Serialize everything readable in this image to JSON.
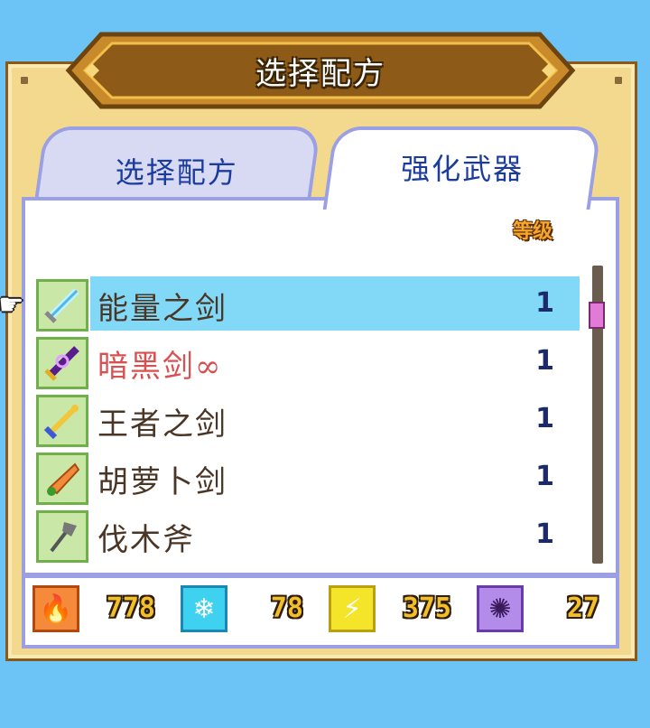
{
  "title": "选择配方",
  "tabs": {
    "recipe": "选择配方",
    "enhance": "强化武器"
  },
  "list_header": {
    "level": "等级"
  },
  "weapons": [
    {
      "name": "能量之剑",
      "level": "1",
      "icon": "energy-sword-icon",
      "selected": true
    },
    {
      "name": "暗黑剑∞",
      "level": "1",
      "icon": "dark-sword-icon",
      "selected": false
    },
    {
      "name": "王者之剑",
      "level": "1",
      "icon": "king-sword-icon",
      "selected": false
    },
    {
      "name": "胡萝卜剑",
      "level": "1",
      "icon": "carrot-sword-icon",
      "selected": false
    },
    {
      "name": "伐木斧",
      "level": "1",
      "icon": "woodcutter-axe-icon",
      "selected": false
    }
  ],
  "resources": {
    "fire": {
      "icon": "fire-icon",
      "value": "778",
      "color": "#f58a3a"
    },
    "ice": {
      "icon": "ice-crystal-icon",
      "value": "78",
      "color": "#3fd2f0"
    },
    "thunder": {
      "icon": "lightning-icon",
      "value": "375",
      "color": "#f4e52a"
    },
    "dark": {
      "icon": "dark-vortex-icon",
      "value": "27",
      "color": "#b38be8"
    }
  },
  "colors": {
    "background": "#6cc3f5",
    "frame": "#f3d98e",
    "selected_row": "#82d9f7",
    "tab_text": "#1b3c9c",
    "dark_weapon_text": "#d85050"
  }
}
